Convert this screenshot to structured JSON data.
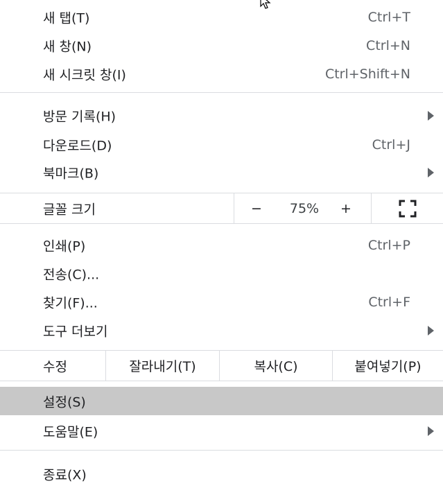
{
  "menu": {
    "new_tab": {
      "label": "새 탭(T)",
      "shortcut": "Ctrl+T"
    },
    "new_window": {
      "label": "새 창(N)",
      "shortcut": "Ctrl+N"
    },
    "new_incognito": {
      "label": "새 시크릿 창(I)",
      "shortcut": "Ctrl+Shift+N"
    },
    "history": {
      "label": "방문 기록(H)"
    },
    "downloads": {
      "label": "다운로드(D)",
      "shortcut": "Ctrl+J"
    },
    "bookmarks": {
      "label": "북마크(B)"
    },
    "zoom": {
      "label": "글꼴 크기",
      "minus": "−",
      "value": "75%",
      "plus": "+",
      "fullscreen_icon": "fullscreen-icon"
    },
    "print": {
      "label": "인쇄(P)",
      "shortcut": "Ctrl+P"
    },
    "cast": {
      "label": "전송(C)..."
    },
    "find": {
      "label": "찾기(F)...",
      "shortcut": "Ctrl+F"
    },
    "more_tools": {
      "label": "도구 더보기"
    },
    "edit": {
      "label": "수정",
      "cut": "잘라내기(T)",
      "copy": "복사(C)",
      "paste": "붙여넣기(P)"
    },
    "settings": {
      "label": "설정(S)"
    },
    "help": {
      "label": "도움말(E)"
    },
    "exit": {
      "label": "종료(X)"
    }
  },
  "colors": {
    "highlight": "#c8c8c8",
    "separator": "#dadce0",
    "text": "#202124",
    "secondary": "#5f6368"
  }
}
